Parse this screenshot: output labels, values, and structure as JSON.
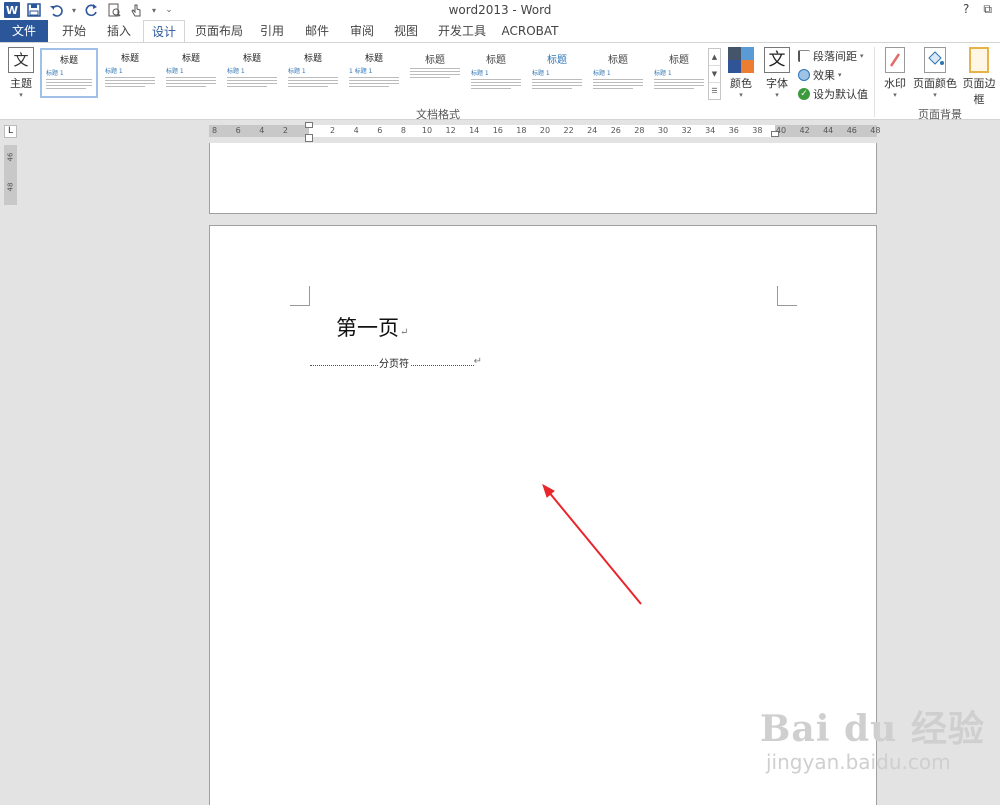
{
  "window": {
    "title": "word2013 - Word",
    "help": "?",
    "restore": "⧉"
  },
  "qat": {
    "word_icon": "W",
    "save_icon": "save-icon",
    "undo_icon": "undo-icon",
    "redo_icon": "redo-icon",
    "preview_icon": "print-preview-icon",
    "touch_icon": "touch-mode-icon",
    "customize_icon": "customize-icon"
  },
  "tabs": [
    "文件",
    "开始",
    "插入",
    "设计",
    "页面布局",
    "引用",
    "邮件",
    "审阅",
    "视图",
    "开发工具",
    "ACROBAT"
  ],
  "active_tab": "设计",
  "ribbon": {
    "theme_label": "主题",
    "theme_glyph": "文",
    "gallery_items": [
      {
        "heading": "标题",
        "sub": "标题 1",
        "selected": true
      },
      {
        "heading": "标题",
        "sub": "标题 1",
        "selected": false
      },
      {
        "heading": "标题",
        "sub": "标题 1",
        "selected": false
      },
      {
        "heading": "标题",
        "sub": "标题 1",
        "selected": false
      },
      {
        "heading": "标题",
        "sub": "标题 1",
        "selected": false
      },
      {
        "heading": "标题",
        "sub": "1 标题 1",
        "selected": false
      },
      {
        "heading": "标题",
        "sub": "",
        "selected": false
      },
      {
        "heading": "标题",
        "sub": "标题 1",
        "selected": false
      },
      {
        "heading": "标题",
        "sub": "标题 1",
        "selected": false
      },
      {
        "heading": "标题",
        "sub": "标题 1",
        "selected": false
      },
      {
        "heading": "标题",
        "sub": "标题 1",
        "selected": false
      }
    ],
    "document_format_label": "文档格式",
    "colors_label": "颜色",
    "fonts_label": "字体",
    "fonts_glyph": "文",
    "paragraph_spacing_label": "段落间距",
    "effects_label": "效果",
    "set_default_label": "设为默认值",
    "watermark_label": "水印",
    "page_color_label": "页面颜色",
    "page_borders_label": "页面边框",
    "page_background_label": "页面背景",
    "colors": {
      "accent": "#2b579a",
      "swatch1": "#2f5597",
      "swatch2": "#ed7d31",
      "swatch3": "#44546a",
      "swatch4": "#5b9bd5"
    }
  },
  "ruler": {
    "tab_selector": "L",
    "numbers": [
      "8",
      "6",
      "4",
      "2",
      "",
      "2",
      "4",
      "6",
      "8",
      "10",
      "12",
      "14",
      "16",
      "18",
      "20",
      "22",
      "24",
      "26",
      "28",
      "30",
      "32",
      "34",
      "36",
      "38",
      "40",
      "42",
      "44",
      "46",
      "48"
    ],
    "vertical_numbers": [
      "46",
      "48"
    ]
  },
  "document": {
    "page2_heading": "第一页",
    "paragraph_mark": "↵",
    "page_break_label": "分页符"
  },
  "watermark_text": {
    "brand": "Bai du 经验",
    "url": "jingyan.baidu.com"
  },
  "annotation": {
    "arrow_color": "#e8262b"
  }
}
